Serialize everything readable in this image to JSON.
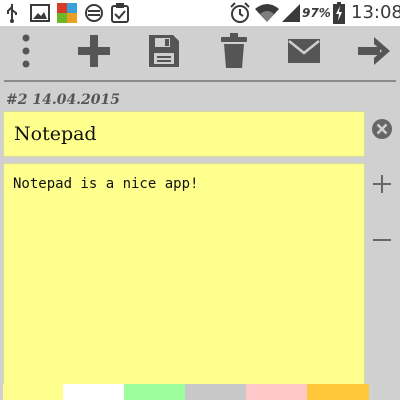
{
  "status_bar": {
    "icons": [
      "usb-icon",
      "image-icon",
      "app-icon",
      "blocked-icon",
      "clipboard-check-icon",
      "alarm-icon",
      "wifi-icon",
      "signal-icon",
      "battery-charging-icon"
    ],
    "battery_percent": "97%",
    "time": "13:08"
  },
  "toolbar": {
    "actions": [
      "menu",
      "add",
      "save",
      "delete",
      "email",
      "next"
    ]
  },
  "note": {
    "meta": "#2  14.04.2015",
    "title": "Notepad",
    "body": "Notepad is a nice app!"
  },
  "side_actions": [
    "clear",
    "zoom-in",
    "zoom-out"
  ],
  "colors": {
    "note_background": "#ffff8d",
    "swatches": [
      "#ffff8d",
      "#ffffff",
      "#9cff9c",
      "#c8c8c8",
      "#ffc8c8",
      "#ffc83c"
    ]
  }
}
